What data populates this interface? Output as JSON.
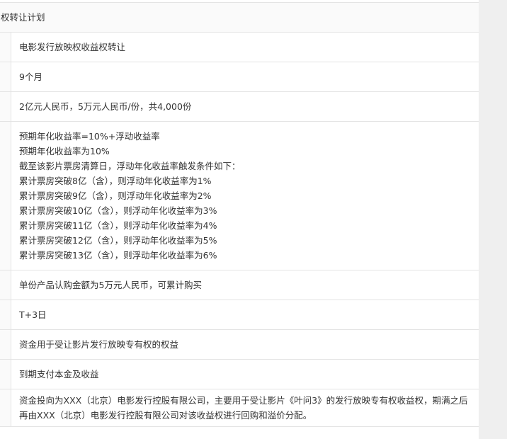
{
  "table": {
    "title": "权转让计划",
    "rows": [
      {
        "lines": [
          "电影发行放映权收益权转让"
        ]
      },
      {
        "lines": [
          "9个月"
        ]
      },
      {
        "lines": [
          "2亿元人民币，5万元人民币/份，共4,000份"
        ]
      },
      {
        "lines": [
          "预期年化收益率=10%+浮动收益率",
          "预期年化收益率为10%",
          "截至该影片票房清算日，浮动年化收益率触发条件如下：",
          "累计票房突破8亿（含），则浮动年化收益率为1%",
          "累计票房突破9亿（含），则浮动年化收益率为2%",
          "累计票房突破10亿（含），则浮动年化收益率为3%",
          "累计票房突破11亿（含），则浮动年化收益率为4%",
          "累计票房突破12亿（含），则浮动年化收益率为5%",
          "累计票房突破13亿（含），则浮动年化收益率为6%"
        ]
      },
      {
        "lines": [
          "单份产品认购金额为5万元人民币，可累计购买"
        ]
      },
      {
        "lines": [
          "T+3日"
        ]
      },
      {
        "lines": [
          "资金用于受让影片发行放映专有权的权益"
        ]
      },
      {
        "lines": [
          "到期支付本金及收益"
        ]
      },
      {
        "text": "资金投向为XXX（北京）电影发行控股有限公司，主要用于受让影片《叶问3》的发行放映专有权收益权，期满之后再由XXX（北京）电影发行控股有限公司对该收益权进行回购和溢价分配。"
      }
    ]
  }
}
